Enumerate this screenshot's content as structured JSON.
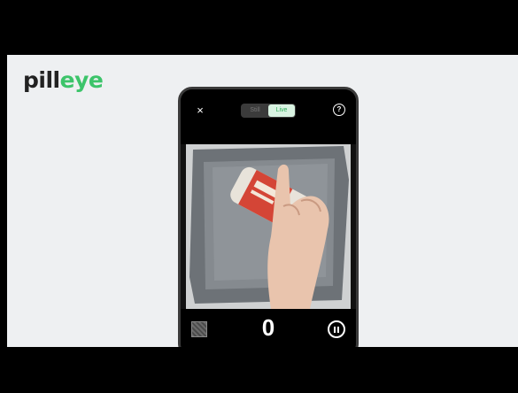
{
  "brand": {
    "part1": "pill",
    "part2": "eye"
  },
  "phone": {
    "close_icon": "×",
    "modes": [
      {
        "label": "Still",
        "active": false
      },
      {
        "label": "Live",
        "active": true
      }
    ],
    "help_icon": "?",
    "pill_count": "0"
  },
  "colors": {
    "accent": "#3cc46a",
    "stage_bg": "#eef0f2"
  }
}
